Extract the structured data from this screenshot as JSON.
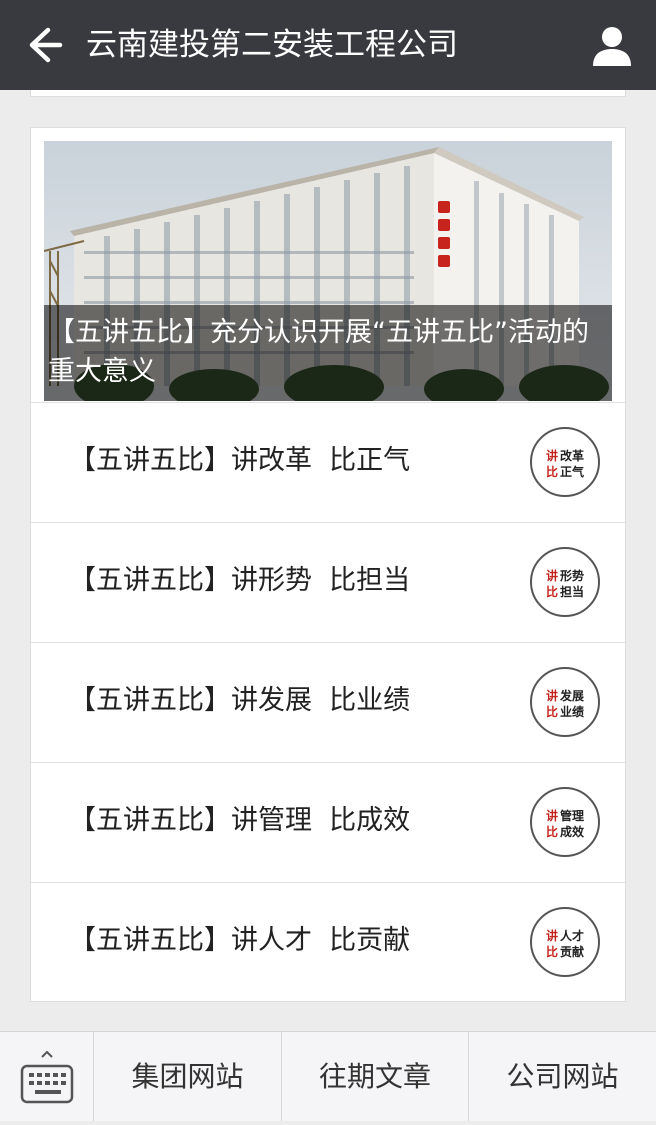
{
  "header": {
    "title": "云南建投第二安装工程公司",
    "back_icon": "arrow-left-icon",
    "profile_icon": "person-icon"
  },
  "article_card": {
    "cover": {
      "caption": "【五讲五比】充分认识开展“五讲五比”活动的重大意义",
      "building_sign": "云南建投"
    },
    "items": [
      {
        "title": "【五讲五比】讲改革  比正气",
        "thumb": [
          "讲",
          "改革",
          "比",
          "正气"
        ]
      },
      {
        "title": "【五讲五比】讲形势  比担当",
        "thumb": [
          "讲",
          "形势",
          "比",
          "担当"
        ]
      },
      {
        "title": "【五讲五比】讲发展  比业绩",
        "thumb": [
          "讲",
          "发展",
          "比",
          "业绩"
        ]
      },
      {
        "title": "【五讲五比】讲管理  比成效",
        "thumb": [
          "讲",
          "管理",
          "比",
          "成效"
        ]
      },
      {
        "title": "【五讲五比】讲人才  比贡献",
        "thumb": [
          "讲",
          "人才",
          "比",
          "贡献"
        ]
      }
    ]
  },
  "bottom_menu": {
    "keyboard_icon": "keyboard-icon",
    "items": [
      "集团网站",
      "往期文章",
      "公司网站"
    ]
  },
  "colors": {
    "header_bg": "#393a3f",
    "page_bg": "#ececec",
    "thumb_accent": "#c8241e"
  }
}
